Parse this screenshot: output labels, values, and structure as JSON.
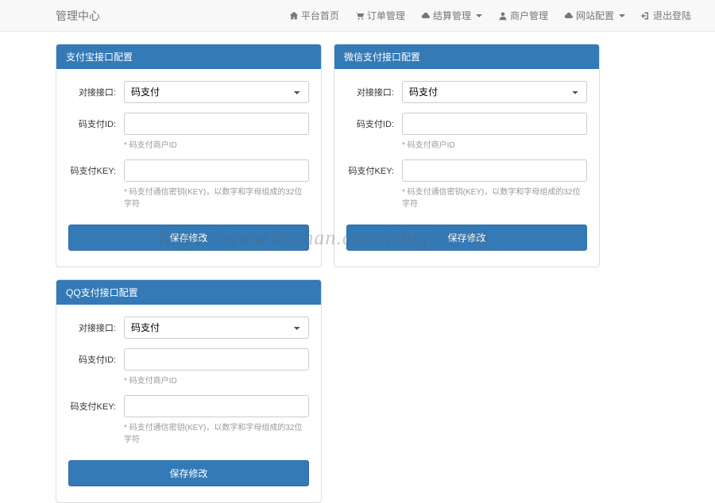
{
  "navbar": {
    "brand": "管理中心",
    "items": [
      {
        "label": "平台首页",
        "dropdown": false
      },
      {
        "label": "订单管理",
        "dropdown": false
      },
      {
        "label": "结算管理",
        "dropdown": true
      },
      {
        "label": "商户管理",
        "dropdown": false
      },
      {
        "label": "网站配置",
        "dropdown": true
      },
      {
        "label": "退出登陆",
        "dropdown": false
      }
    ]
  },
  "panels": {
    "alipay": {
      "title": "支付宝接口配置",
      "interface_label": "对接接口:",
      "interface_value": "码支付",
      "id_label": "码支付ID:",
      "id_value": "",
      "id_help": "* 码支付商户ID",
      "key_label": "码支付KEY:",
      "key_value": "",
      "key_help": "* 码支付通信密钥(KEY)，以数字和字母组成的32位字符",
      "submit": "保存修改"
    },
    "wechat": {
      "title": "微信支付接口配置",
      "interface_label": "对接接口:",
      "interface_value": "码支付",
      "id_label": "码支付ID:",
      "id_value": "",
      "id_help": "* 码支付商户ID",
      "key_label": "码支付KEY:",
      "key_value": "",
      "key_help": "* 码支付通信密钥(KEY)，以数字和字母组成的32位字符",
      "submit": "保存修改"
    },
    "qq": {
      "title": "QQ支付接口配置",
      "interface_label": "对接接口:",
      "interface_value": "码支付",
      "id_label": "码支付ID:",
      "id_value": "",
      "id_help": "* 码支付商户ID",
      "key_label": "码支付KEY:",
      "key_value": "",
      "key_help": "* 码支付通信密钥(KEY)，以数字和字母组成的32位字符",
      "submit": "保存修改"
    }
  },
  "watermark": "https://www.huzhan.com/ishop21106"
}
